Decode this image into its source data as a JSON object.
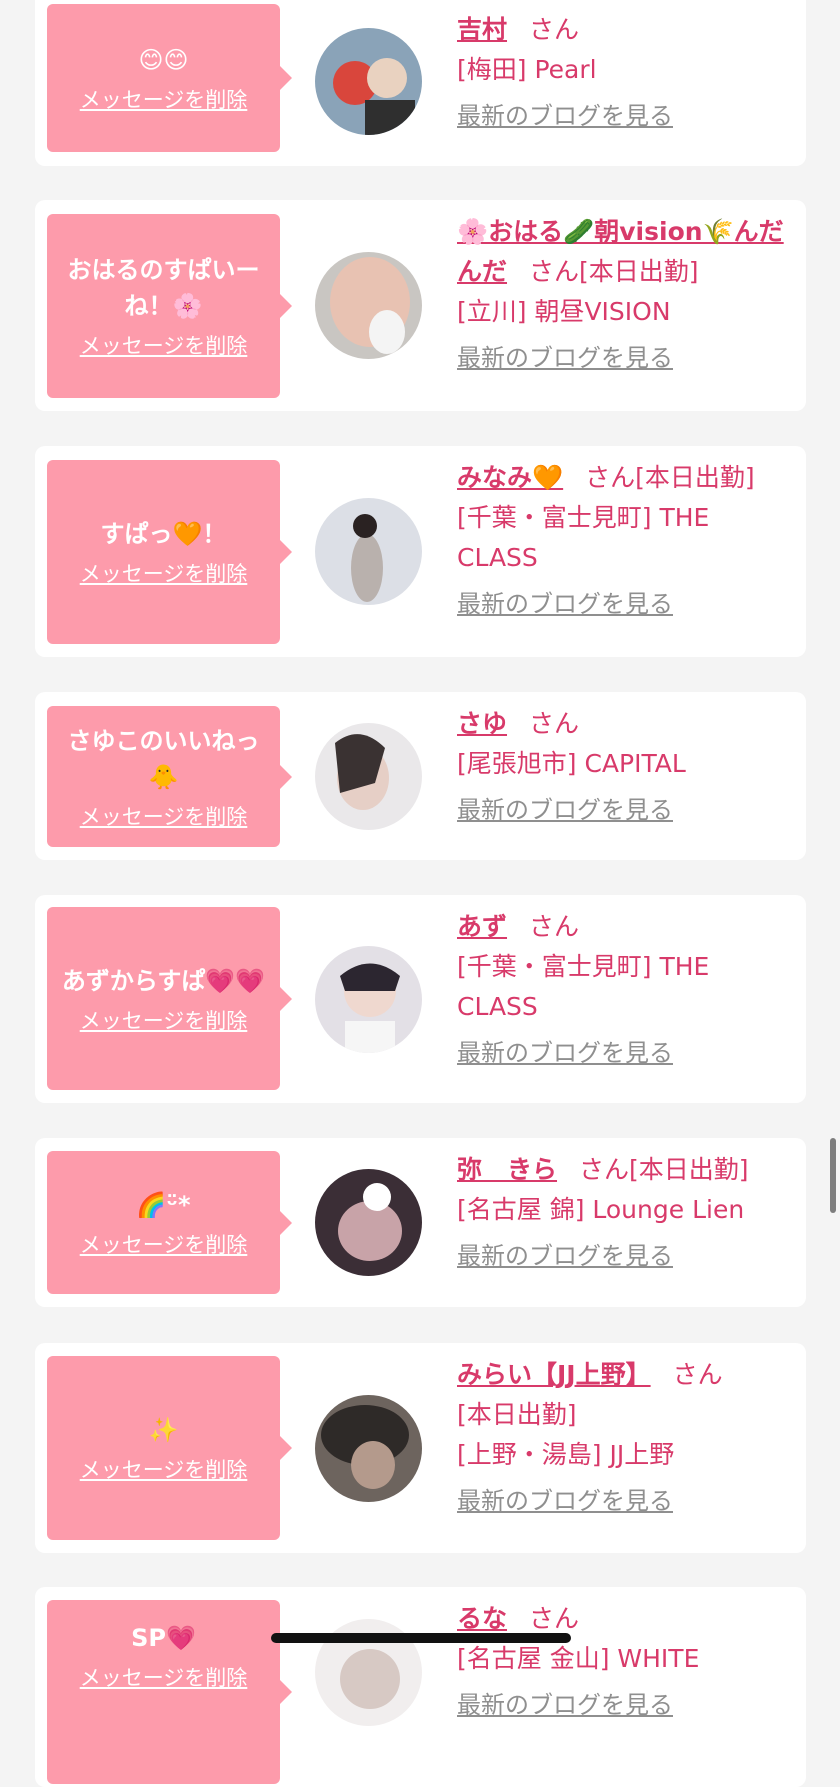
{
  "entries": [
    {
      "message": "😊😊",
      "delete_label": "メッセージを削除",
      "name": "吉村",
      "honorific": "さん",
      "status": "",
      "shop": "[梅田] Pearl",
      "blog_label": "最新のブログを見る",
      "avatar_colors": [
        "#8aa3b8",
        "#d9463c"
      ]
    },
    {
      "message": "おはるのすぱいーね！🌸",
      "delete_label": "メッセージを削除",
      "name": "🌸おはる🥒朝vision🌾んだんだ",
      "honorific": "さん",
      "status": "[本日出勤]",
      "shop": "[立川] 朝昼VISION",
      "blog_label": "最新のブログを見る",
      "avatar_colors": [
        "#c9c6c2",
        "#e8c2b2"
      ]
    },
    {
      "message": "すぱっ🧡！",
      "delete_label": "メッセージを削除",
      "name": "みなみ🧡",
      "honorific": "さん",
      "status": "[本日出勤]",
      "shop": "[千葉・富士見町] THE CLASS",
      "blog_label": "最新のブログを見る",
      "avatar_colors": [
        "#dcdfe6",
        "#b9b1ad"
      ]
    },
    {
      "message": "さゆこのいいねっ🐥",
      "delete_label": "メッセージを削除",
      "name": "さゆ",
      "honorific": "さん",
      "status": "",
      "shop": "[尾張旭市] CAPITAL",
      "blog_label": "最新のブログを見る",
      "avatar_colors": [
        "#eae8ea",
        "#3a3232"
      ]
    },
    {
      "message": "あずからすぱ💗💗",
      "delete_label": "メッセージを削除",
      "name": "あず",
      "honorific": "さん",
      "status": "",
      "shop": "[千葉・富士見町] THE CLASS",
      "blog_label": "最新のブログを見る",
      "avatar_colors": [
        "#e3e0e6",
        "#2c2630"
      ]
    },
    {
      "message": "🌈ᵕ̈*",
      "delete_label": "メッセージを削除",
      "name": "弥　きら",
      "honorific": "さん",
      "status": "[本日出勤]",
      "shop": "[名古屋 錦] Lounge Lien",
      "blog_label": "最新のブログを見る",
      "avatar_colors": [
        "#3b2e36",
        "#c8a3a8"
      ]
    },
    {
      "message": "✨",
      "delete_label": "メッセージを削除",
      "name": "みらい【JJ上野】",
      "honorific": "さん",
      "status": "[本日出勤]",
      "shop": "[上野・湯島] JJ上野",
      "blog_label": "最新のブログを見る",
      "avatar_colors": [
        "#2e2a28",
        "#6d645e"
      ]
    },
    {
      "message": "SP💗",
      "delete_label": "メッセージを削除",
      "name": "るな",
      "honorific": "さん",
      "status": "",
      "shop": "[名古屋 金山] WHITE",
      "blog_label": "最新のブログを見る",
      "avatar_colors": [
        "#f1eeee",
        "#d7c9c4"
      ]
    }
  ]
}
